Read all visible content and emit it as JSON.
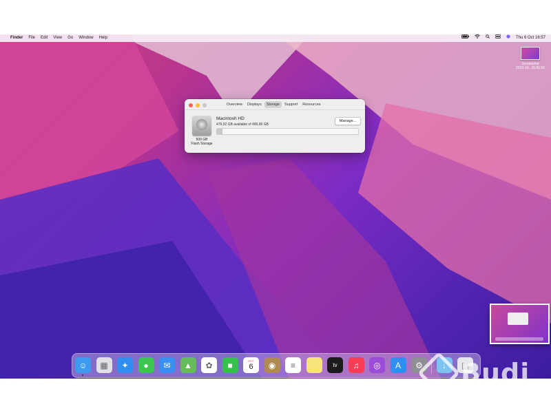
{
  "menubar": {
    "apple_icon": "",
    "app_name": "Finder",
    "menus": [
      "File",
      "Edit",
      "View",
      "Go",
      "Window",
      "Help"
    ],
    "clock": "Thu 6 Oct  16:57",
    "status_icons": [
      "battery-icon",
      "wifi-icon",
      "search-icon",
      "control-center-icon",
      "siri-icon"
    ]
  },
  "desktop": {
    "file_label_line1": "Screenshot",
    "file_label_line2": "2022-10...16.56.56"
  },
  "about_window": {
    "tabs": [
      "Overview",
      "Displays",
      "Storage",
      "Support",
      "Resources"
    ],
    "active_tab": "Storage",
    "volume_name": "Macintosh HD",
    "available_text": "479,92 GB available of 499,96 GB",
    "capacity": "500 GB",
    "storage_type": "Flash Storage",
    "manage_label": "Manage...",
    "used_fraction": 0.04
  },
  "dock": {
    "calendar_month": "OCT",
    "calendar_day": "6",
    "apps": [
      {
        "name": "finder-icon",
        "color": "#3d9af0"
      },
      {
        "name": "launchpad-icon",
        "color": "#e0e0e6"
      },
      {
        "name": "safari-icon",
        "color": "#2f8ef0"
      },
      {
        "name": "messages-icon",
        "color": "#3cc54f"
      },
      {
        "name": "mail-icon",
        "color": "#3a8ff5"
      },
      {
        "name": "maps-icon",
        "color": "#66bb5a"
      },
      {
        "name": "photos-icon",
        "color": "#ffffff"
      },
      {
        "name": "facetime-icon",
        "color": "#35c14b"
      },
      {
        "name": "calendar-icon",
        "color": "#ffffff"
      },
      {
        "name": "contacts-icon",
        "color": "#b08a55"
      },
      {
        "name": "reminders-icon",
        "color": "#ffffff"
      },
      {
        "name": "notes-icon",
        "color": "#f8e27a"
      },
      {
        "name": "tv-icon",
        "color": "#1c1c1e"
      },
      {
        "name": "music-icon",
        "color": "#fb3c55"
      },
      {
        "name": "podcasts-icon",
        "color": "#9b4cd8"
      },
      {
        "name": "app-store-icon",
        "color": "#2f8ef0"
      },
      {
        "name": "system-preferences-icon",
        "color": "#8e8e93"
      },
      {
        "name": "downloads-folder-icon",
        "color": "#7cc3f0"
      },
      {
        "name": "trash-icon",
        "color": "#e8e8ec"
      }
    ]
  },
  "watermark": {
    "text": "Budi"
  }
}
